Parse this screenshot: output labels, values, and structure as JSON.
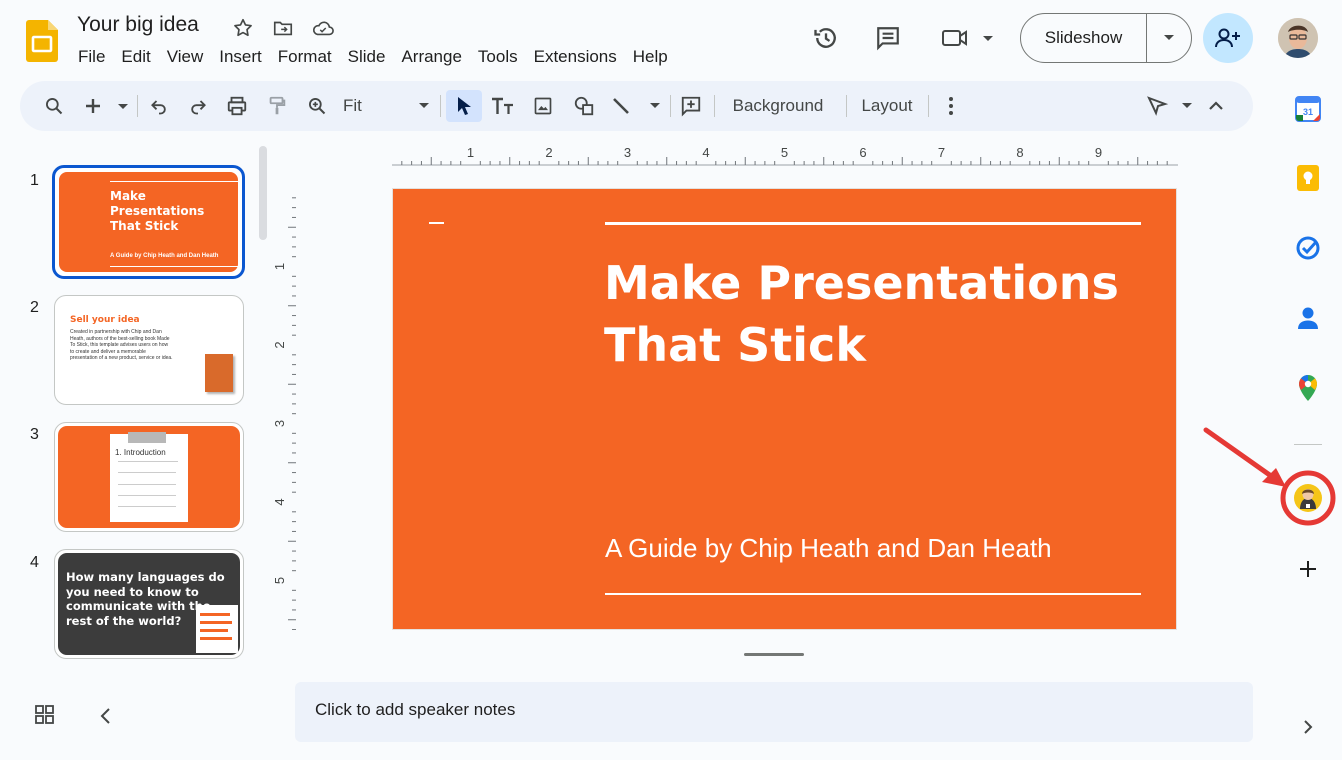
{
  "document": {
    "title": "Your big idea"
  },
  "menu": [
    "File",
    "Edit",
    "View",
    "Insert",
    "Format",
    "Slide",
    "Arrange",
    "Tools",
    "Extensions",
    "Help"
  ],
  "header": {
    "slideshow_label": "Slideshow"
  },
  "toolbar": {
    "zoom_value": "Fit",
    "background_label": "Background",
    "layout_label": "Layout"
  },
  "filmstrip": {
    "slides": [
      {
        "number": "1",
        "title": "Make Presentations That Stick",
        "subtitle": "A Guide by Chip Heath and Dan Heath"
      },
      {
        "number": "2",
        "title": "Sell your idea",
        "body": "Created in partnership with Chip and Dan Heath, authors of the best-selling book Made To Stick, this template advises users on how to create and deliver a memorable presentation of a new product, service or idea."
      },
      {
        "number": "3",
        "title": "1. Introduction"
      },
      {
        "number": "4",
        "title": "How many languages do you need to know to communicate with the rest of the world?"
      }
    ]
  },
  "ruler": {
    "h_ticks": [
      "1",
      "2",
      "3",
      "4",
      "5",
      "6",
      "7",
      "8",
      "9"
    ],
    "v_ticks": [
      "1",
      "2",
      "3",
      "4",
      "5"
    ]
  },
  "slide": {
    "title": "Make Presentations\nThat Stick",
    "subtitle": "A Guide by Chip Heath and Dan Heath",
    "accent": "#f46524"
  },
  "notes": {
    "placeholder": "Click to add speaker notes"
  },
  "side_panel": {
    "calendar_day": "31"
  }
}
